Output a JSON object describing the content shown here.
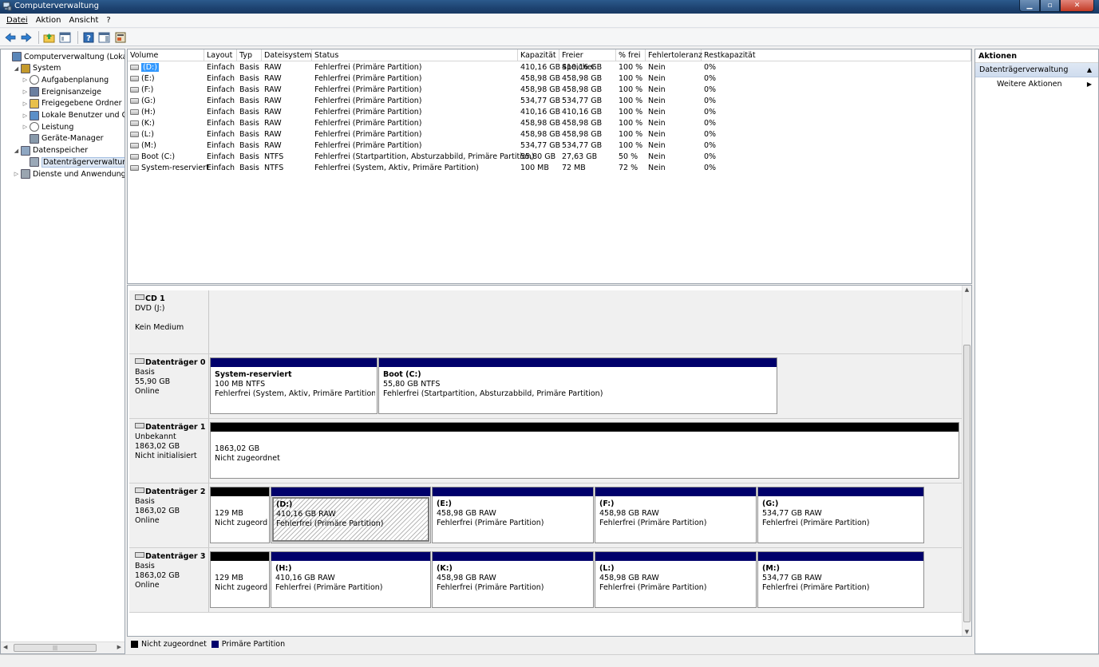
{
  "window": {
    "title": "Computerverwaltung"
  },
  "menu": [
    "Datei",
    "Aktion",
    "Ansicht",
    "?"
  ],
  "tree": [
    {
      "label": "Computerverwaltung (Lokal)",
      "level": 0,
      "exp": "",
      "icon": "computer-icon"
    },
    {
      "label": "System",
      "level": 1,
      "exp": "◢",
      "icon": "tools-icon"
    },
    {
      "label": "Aufgabenplanung",
      "level": 2,
      "exp": "▷",
      "icon": "clock-icon"
    },
    {
      "label": "Ereignisanzeige",
      "level": 2,
      "exp": "▷",
      "icon": "event-viewer-icon"
    },
    {
      "label": "Freigegebene Ordner",
      "level": 2,
      "exp": "▷",
      "icon": "shared-folder-icon"
    },
    {
      "label": "Lokale Benutzer und Gruppen",
      "level": 2,
      "exp": "▷",
      "icon": "users-icon"
    },
    {
      "label": "Leistung",
      "level": 2,
      "exp": "▷",
      "icon": "performance-icon"
    },
    {
      "label": "Geräte-Manager",
      "level": 2,
      "exp": "",
      "icon": "device-manager-icon"
    },
    {
      "label": "Datenspeicher",
      "level": 1,
      "exp": "◢",
      "icon": "storage-icon"
    },
    {
      "label": "Datenträgerverwaltung",
      "level": 2,
      "exp": "",
      "icon": "disk-management-icon",
      "selected": true
    },
    {
      "label": "Dienste und Anwendungen",
      "level": 1,
      "exp": "▷",
      "icon": "services-icon"
    }
  ],
  "volume_table": {
    "columns": [
      "Volume",
      "Layout",
      "Typ",
      "Dateisystem",
      "Status",
      "Kapazität",
      "Freier Speicher",
      "% frei",
      "Fehlertoleranz",
      "Restkapazität"
    ],
    "rows": [
      [
        "(D:)",
        "Einfach",
        "Basis",
        "RAW",
        "Fehlerfrei (Primäre Partition)",
        "410,16 GB",
        "410,16 GB",
        "100 %",
        "Nein",
        "0%"
      ],
      [
        "(E:)",
        "Einfach",
        "Basis",
        "RAW",
        "Fehlerfrei (Primäre Partition)",
        "458,98 GB",
        "458,98 GB",
        "100 %",
        "Nein",
        "0%"
      ],
      [
        "(F:)",
        "Einfach",
        "Basis",
        "RAW",
        "Fehlerfrei (Primäre Partition)",
        "458,98 GB",
        "458,98 GB",
        "100 %",
        "Nein",
        "0%"
      ],
      [
        "(G:)",
        "Einfach",
        "Basis",
        "RAW",
        "Fehlerfrei (Primäre Partition)",
        "534,77 GB",
        "534,77 GB",
        "100 %",
        "Nein",
        "0%"
      ],
      [
        "(H:)",
        "Einfach",
        "Basis",
        "RAW",
        "Fehlerfrei (Primäre Partition)",
        "410,16 GB",
        "410,16 GB",
        "100 %",
        "Nein",
        "0%"
      ],
      [
        "(K:)",
        "Einfach",
        "Basis",
        "RAW",
        "Fehlerfrei (Primäre Partition)",
        "458,98 GB",
        "458,98 GB",
        "100 %",
        "Nein",
        "0%"
      ],
      [
        "(L:)",
        "Einfach",
        "Basis",
        "RAW",
        "Fehlerfrei (Primäre Partition)",
        "458,98 GB",
        "458,98 GB",
        "100 %",
        "Nein",
        "0%"
      ],
      [
        "(M:)",
        "Einfach",
        "Basis",
        "RAW",
        "Fehlerfrei (Primäre Partition)",
        "534,77 GB",
        "534,77 GB",
        "100 %",
        "Nein",
        "0%"
      ],
      [
        "Boot (C:)",
        "Einfach",
        "Basis",
        "NTFS",
        "Fehlerfrei (Startpartition, Absturzabbild, Primäre Partition)",
        "55,80 GB",
        "27,63 GB",
        "50 %",
        "Nein",
        "0%"
      ],
      [
        "System-reserviert",
        "Einfach",
        "Basis",
        "NTFS",
        "Fehlerfrei (System, Aktiv, Primäre Partition)",
        "100 MB",
        "72 MB",
        "72 %",
        "Nein",
        "0%"
      ]
    ]
  },
  "disks": [
    {
      "name": "CD 1",
      "lines": [
        "DVD (J:)",
        "",
        "Kein Medium"
      ],
      "icon": "cd-drive-icon",
      "partitions": []
    },
    {
      "name": "Datenträger 0",
      "lines": [
        "Basis",
        "55,90 GB",
        "Online"
      ],
      "icon": "disk-icon",
      "partitions": [
        {
          "title": "System-reserviert",
          "size": "100 MB NTFS",
          "status": "Fehlerfrei (System, Aktiv, Primäre Partition)",
          "kind": "prim"
        },
        {
          "title": "Boot  (C:)",
          "size": "55,80 GB NTFS",
          "status": "Fehlerfrei (Startpartition, Absturzabbild, Primäre Partition)",
          "kind": "prim"
        }
      ]
    },
    {
      "name": "Datenträger 1",
      "lines": [
        "Unbekannt",
        "1863,02 GB",
        "Nicht initialisiert"
      ],
      "icon": "disk-warning-icon",
      "partitions": [
        {
          "title": "",
          "size": "1863,02 GB",
          "status": "Nicht zugeordnet",
          "kind": "unalloc"
        }
      ]
    },
    {
      "name": "Datenträger 2",
      "lines": [
        "Basis",
        "1863,02 GB",
        "Online"
      ],
      "icon": "disk-icon",
      "partitions": [
        {
          "title": "",
          "size": "129 MB",
          "status": "Nicht zugeord",
          "kind": "unalloc"
        },
        {
          "title": "(D:)",
          "size": "410,16 GB RAW",
          "status": "Fehlerfrei (Primäre Partition)",
          "kind": "prim",
          "hatched": true
        },
        {
          "title": "(E:)",
          "size": "458,98 GB RAW",
          "status": "Fehlerfrei (Primäre Partition)",
          "kind": "prim"
        },
        {
          "title": "(F:)",
          "size": "458,98 GB RAW",
          "status": "Fehlerfrei (Primäre Partition)",
          "kind": "prim"
        },
        {
          "title": "(G:)",
          "size": "534,77 GB RAW",
          "status": "Fehlerfrei (Primäre Partition)",
          "kind": "prim"
        }
      ]
    },
    {
      "name": "Datenträger 3",
      "lines": [
        "Basis",
        "1863,02 GB",
        "Online"
      ],
      "icon": "disk-icon",
      "partitions": [
        {
          "title": "",
          "size": "129 MB",
          "status": "Nicht zugeord",
          "kind": "unalloc"
        },
        {
          "title": "(H:)",
          "size": "410,16 GB RAW",
          "status": "Fehlerfrei (Primäre Partition)",
          "kind": "prim"
        },
        {
          "title": "(K:)",
          "size": "458,98 GB RAW",
          "status": "Fehlerfrei (Primäre Partition)",
          "kind": "prim"
        },
        {
          "title": "(L:)",
          "size": "458,98 GB RAW",
          "status": "Fehlerfrei (Primäre Partition)",
          "kind": "prim"
        },
        {
          "title": "(M:)",
          "size": "534,77 GB RAW",
          "status": "Fehlerfrei (Primäre Partition)",
          "kind": "prim"
        }
      ]
    }
  ],
  "legend": [
    {
      "label": "Nicht zugeordnet",
      "color": "#000000"
    },
    {
      "label": "Primäre Partition",
      "color": "#00006b"
    }
  ],
  "actions": {
    "header": "Aktionen",
    "section": "Datenträgerverwaltung",
    "item": "Weitere Aktionen"
  },
  "colors": {
    "primary_partition": "#00006b",
    "unallocated": "#000000",
    "selection": "#3399ff"
  }
}
